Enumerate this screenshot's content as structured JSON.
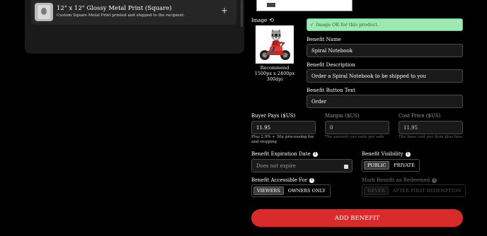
{
  "product": {
    "title": "12\" x 12\" Glossy Metal Print (Square)",
    "subtitle": "Custom Square Metal Print printed and shipped to the recipient.",
    "add_symbol": "+"
  },
  "image_section": {
    "label": "Image",
    "reset_symbol": "⟲",
    "recommend_line1": "Recommend",
    "recommend_line2": "1500px x 2400px",
    "recommend_line3": "300dpi",
    "ok_message": "Image OK for this product."
  },
  "benefit_name": {
    "label": "Benefit Name",
    "value": "Spiral Notebook"
  },
  "benefit_description": {
    "label": "Benefit Description",
    "value": "Order a Spiral Notebook to be shipped to you"
  },
  "benefit_button_text": {
    "label": "Benefit Button Text",
    "value": "Order"
  },
  "buyer_pays": {
    "label": "Buyer Pays ($US)",
    "value": "11.95",
    "helper": "Plus 2.9% + 30¢ processing fee and shipping"
  },
  "margin": {
    "label": "Margin ($US)",
    "value": "0",
    "helper": "The amount you earn per sale"
  },
  "cost_price": {
    "label": "Cost Price ($US)",
    "value": "11.95",
    "helper": "The base cost per item plus fees"
  },
  "expiration": {
    "label": "Benefit Expiration Date",
    "placeholder": "Does not expire"
  },
  "visibility": {
    "label": "Benefit Visibility",
    "options": [
      "PUBLIC",
      "PRIVATE"
    ],
    "selected": "PUBLIC"
  },
  "accessible_for": {
    "label": "Benefit Accessible For",
    "options": [
      "VIEWERS",
      "OWNERS ONLY"
    ],
    "selected": "VIEWERS"
  },
  "mark_redeemed": {
    "label": "Mark Benefit as Redeemed",
    "options": [
      "NEVER",
      "AFTER FIRST REDEMPTION"
    ],
    "selected": "NEVER"
  },
  "submit": {
    "label": "ADD BENEFIT"
  },
  "colors": {
    "accent": "#d92b2b",
    "ok_bg": "#9fe8b3",
    "ok_text": "#1f6b34"
  }
}
